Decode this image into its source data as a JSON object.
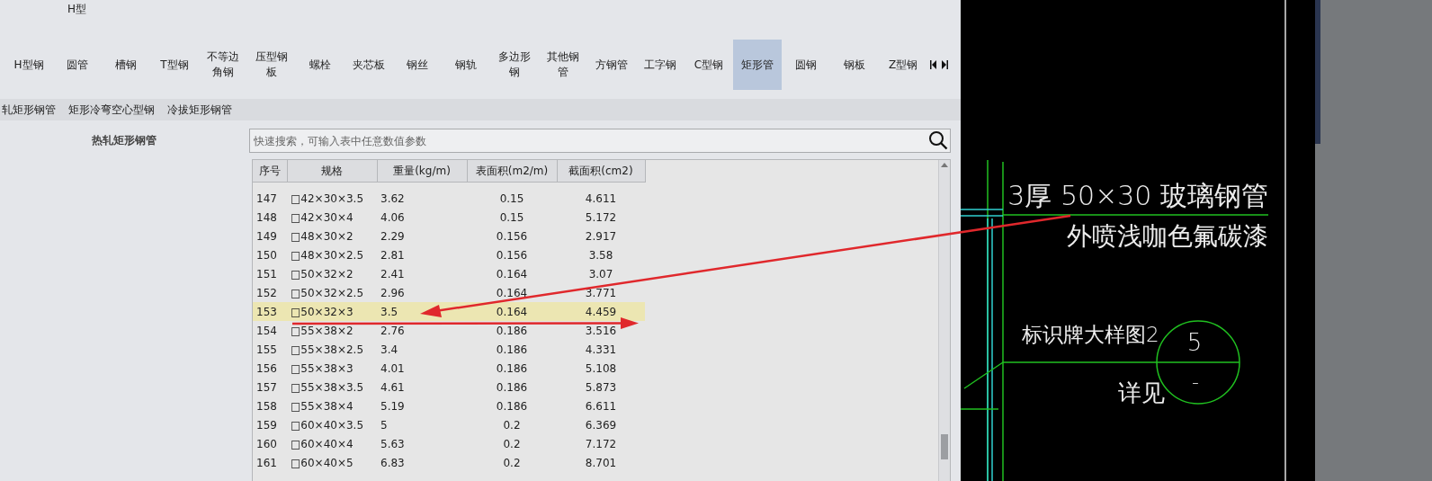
{
  "category_bar": {
    "title": "H型",
    "tabs": [
      {
        "label": "H型钢",
        "selected": false
      },
      {
        "label": "圆管",
        "selected": false
      },
      {
        "label": "槽钢",
        "selected": false
      },
      {
        "label": "T型钢",
        "selected": false
      },
      {
        "label": "不等边角钢",
        "selected": false
      },
      {
        "label": "压型钢板",
        "selected": false
      },
      {
        "label": "螺栓",
        "selected": false
      },
      {
        "label": "夹芯板",
        "selected": false
      },
      {
        "label": "钢丝",
        "selected": false
      },
      {
        "label": "钢轨",
        "selected": false
      },
      {
        "label": "多边形钢",
        "selected": false
      },
      {
        "label": "其他钢管",
        "selected": false
      },
      {
        "label": "方钢管",
        "selected": false
      },
      {
        "label": "工字钢",
        "selected": false
      },
      {
        "label": "C型钢",
        "selected": false
      },
      {
        "label": "矩形管",
        "selected": true
      },
      {
        "label": "圆钢",
        "selected": false
      },
      {
        "label": "钢板",
        "selected": false
      },
      {
        "label": "Z型钢",
        "selected": false
      }
    ]
  },
  "subcategories": [
    "轧矩形钢管",
    "矩形冷弯空心型钢",
    "冷拔矩形钢管"
  ],
  "section_title": "热轧矩形钢管",
  "search": {
    "placeholder": "快速搜索，可输入表中任意数值参数"
  },
  "table": {
    "columns": [
      "序号",
      "规格",
      "重量(kg/m)",
      "表面积(m2/m)",
      "截面积(cm2)"
    ],
    "rows": [
      {
        "cells": [
          "147",
          "□42×30×3.5",
          "3.62",
          "0.15",
          "4.611"
        ],
        "selected": false
      },
      {
        "cells": [
          "148",
          "□42×30×4",
          "4.06",
          "0.15",
          "5.172"
        ],
        "selected": false
      },
      {
        "cells": [
          "149",
          "□48×30×2",
          "2.29",
          "0.156",
          "2.917"
        ],
        "selected": false
      },
      {
        "cells": [
          "150",
          "□48×30×2.5",
          "2.81",
          "0.156",
          "3.58"
        ],
        "selected": false
      },
      {
        "cells": [
          "151",
          "□50×32×2",
          "2.41",
          "0.164",
          "3.07"
        ],
        "selected": false
      },
      {
        "cells": [
          "152",
          "□50×32×2.5",
          "2.96",
          "0.164",
          "3.771"
        ],
        "selected": false
      },
      {
        "cells": [
          "153",
          "□50×32×3",
          "3.5",
          "0.164",
          "4.459"
        ],
        "selected": true
      },
      {
        "cells": [
          "154",
          "□55×38×2",
          "2.76",
          "0.186",
          "3.516"
        ],
        "selected": false
      },
      {
        "cells": [
          "155",
          "□55×38×2.5",
          "3.4",
          "0.186",
          "4.331"
        ],
        "selected": false
      },
      {
        "cells": [
          "156",
          "□55×38×3",
          "4.01",
          "0.186",
          "5.108"
        ],
        "selected": false
      },
      {
        "cells": [
          "157",
          "□55×38×3.5",
          "4.61",
          "0.186",
          "5.873"
        ],
        "selected": false
      },
      {
        "cells": [
          "158",
          "□55×38×4",
          "5.19",
          "0.186",
          "6.611"
        ],
        "selected": false
      },
      {
        "cells": [
          "159",
          "□60×40×3.5",
          "5",
          "0.2",
          "6.369"
        ],
        "selected": false
      },
      {
        "cells": [
          "160",
          "□60×40×4",
          "5.63",
          "0.2",
          "7.172"
        ],
        "selected": false
      },
      {
        "cells": [
          "161",
          "□60×40×5",
          "6.83",
          "0.2",
          "8.701"
        ],
        "selected": false
      }
    ]
  },
  "cad_drawing": {
    "labels": [
      {
        "kind": "leader_top",
        "text": "3厚 50×30 玻璃钢管"
      },
      {
        "kind": "leader_bottom",
        "text": "外喷浅咖色氟碳漆"
      },
      {
        "kind": "detail_title",
        "text": "标识牌大样图2"
      },
      {
        "kind": "detail_note",
        "text": "详见"
      }
    ],
    "detail_circle": {
      "number": "5",
      "sheet": "-"
    }
  }
}
